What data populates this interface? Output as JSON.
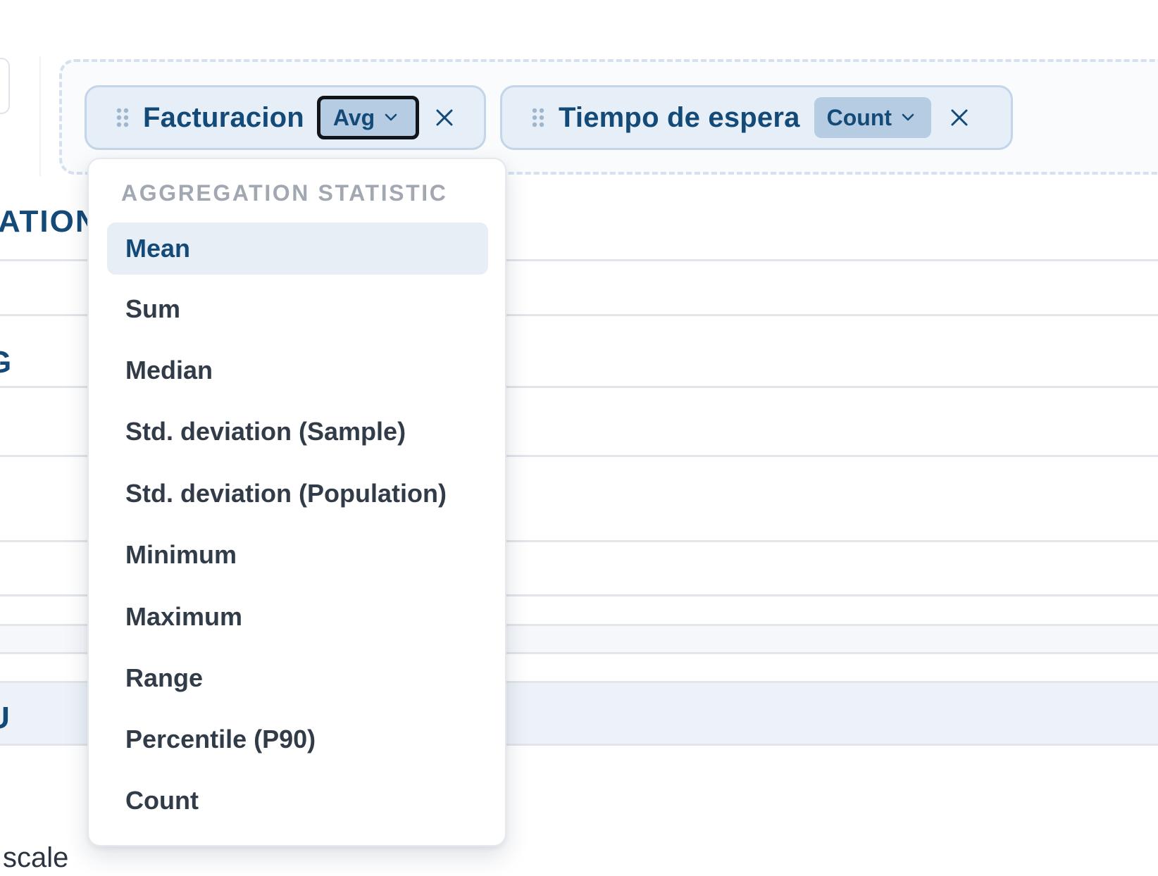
{
  "background": {
    "heading_fragment": "ATION",
    "row_fragment_1": "G",
    "row_fragment_2": "U",
    "footer_fragment": "scale"
  },
  "chips": [
    {
      "label": "Facturacion",
      "aggregation": "Avg",
      "dropdown_open": true
    },
    {
      "label": "Tiempo de espera",
      "aggregation": "Count",
      "dropdown_open": false
    }
  ],
  "dropdown": {
    "heading": "AGGREGATION STATISTIC",
    "selected": "Mean",
    "options": [
      "Mean",
      "Sum",
      "Median",
      "Std. deviation (Sample)",
      "Std. deviation (Population)",
      "Minimum",
      "Maximum",
      "Range",
      "Percentile (P90)",
      "Count"
    ]
  },
  "colors": {
    "brand_text": "#144a78",
    "chip_bg": "#e6eef7",
    "agg_bg": "#b5cce3",
    "active_option_bg": "#e8eef6"
  },
  "icons": {
    "drag": "drag-handle-icon",
    "chevron": "chevron-down-icon",
    "close": "close-icon"
  }
}
